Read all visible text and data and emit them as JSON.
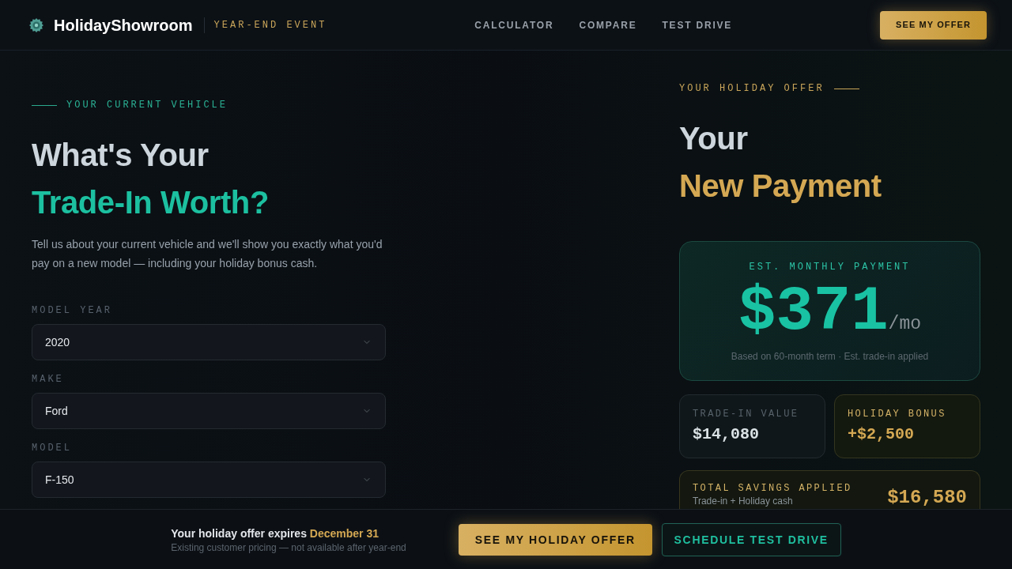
{
  "header": {
    "brand": "HolidayShowroom",
    "event_tag": "YEAR-END EVENT",
    "nav": [
      "CALCULATOR",
      "COMPARE",
      "TEST DRIVE"
    ],
    "cta": "SEE MY OFFER"
  },
  "vehicle": {
    "eyebrow": "YOUR CURRENT VEHICLE",
    "title_line_1": "What's Your",
    "title_line_2": "Trade-In Worth?",
    "intro": "Tell us about your current vehicle and we'll show you exactly what you'd pay on a new model — including your holiday bonus cash.",
    "fields": [
      {
        "label": "MODEL YEAR",
        "value": "2020"
      },
      {
        "label": "MAKE",
        "value": "Ford"
      },
      {
        "label": "MODEL",
        "value": "F-150"
      }
    ]
  },
  "offer": {
    "eyebrow": "YOUR HOLIDAY OFFER",
    "title_line_1": "Your",
    "title_line_2": "New Payment",
    "payment": {
      "label": "EST. MONTHLY PAYMENT",
      "amount": "$371",
      "unit": "/mo",
      "note": "Based on 60-month term · Est. trade-in applied"
    },
    "stats": [
      {
        "kind": "neutral",
        "label": "TRADE-IN VALUE",
        "value": "$14,080"
      },
      {
        "kind": "bonus",
        "label": "HOLIDAY BONUS",
        "value": "+$2,500"
      }
    ],
    "total": {
      "label": "TOTAL SAVINGS APPLIED",
      "note": "Trade-in + Holiday cash",
      "value": "$16,580"
    }
  },
  "bottom_bar": {
    "title": "Your holiday offer expires",
    "date": "December 31",
    "note": "Existing customer pricing — not available after year-end",
    "buttons": [
      {
        "kind": "primary",
        "label": "SEE MY HOLIDAY OFFER"
      },
      {
        "kind": "outline",
        "label": "SCHEDULE TEST DRIVE"
      }
    ]
  }
}
